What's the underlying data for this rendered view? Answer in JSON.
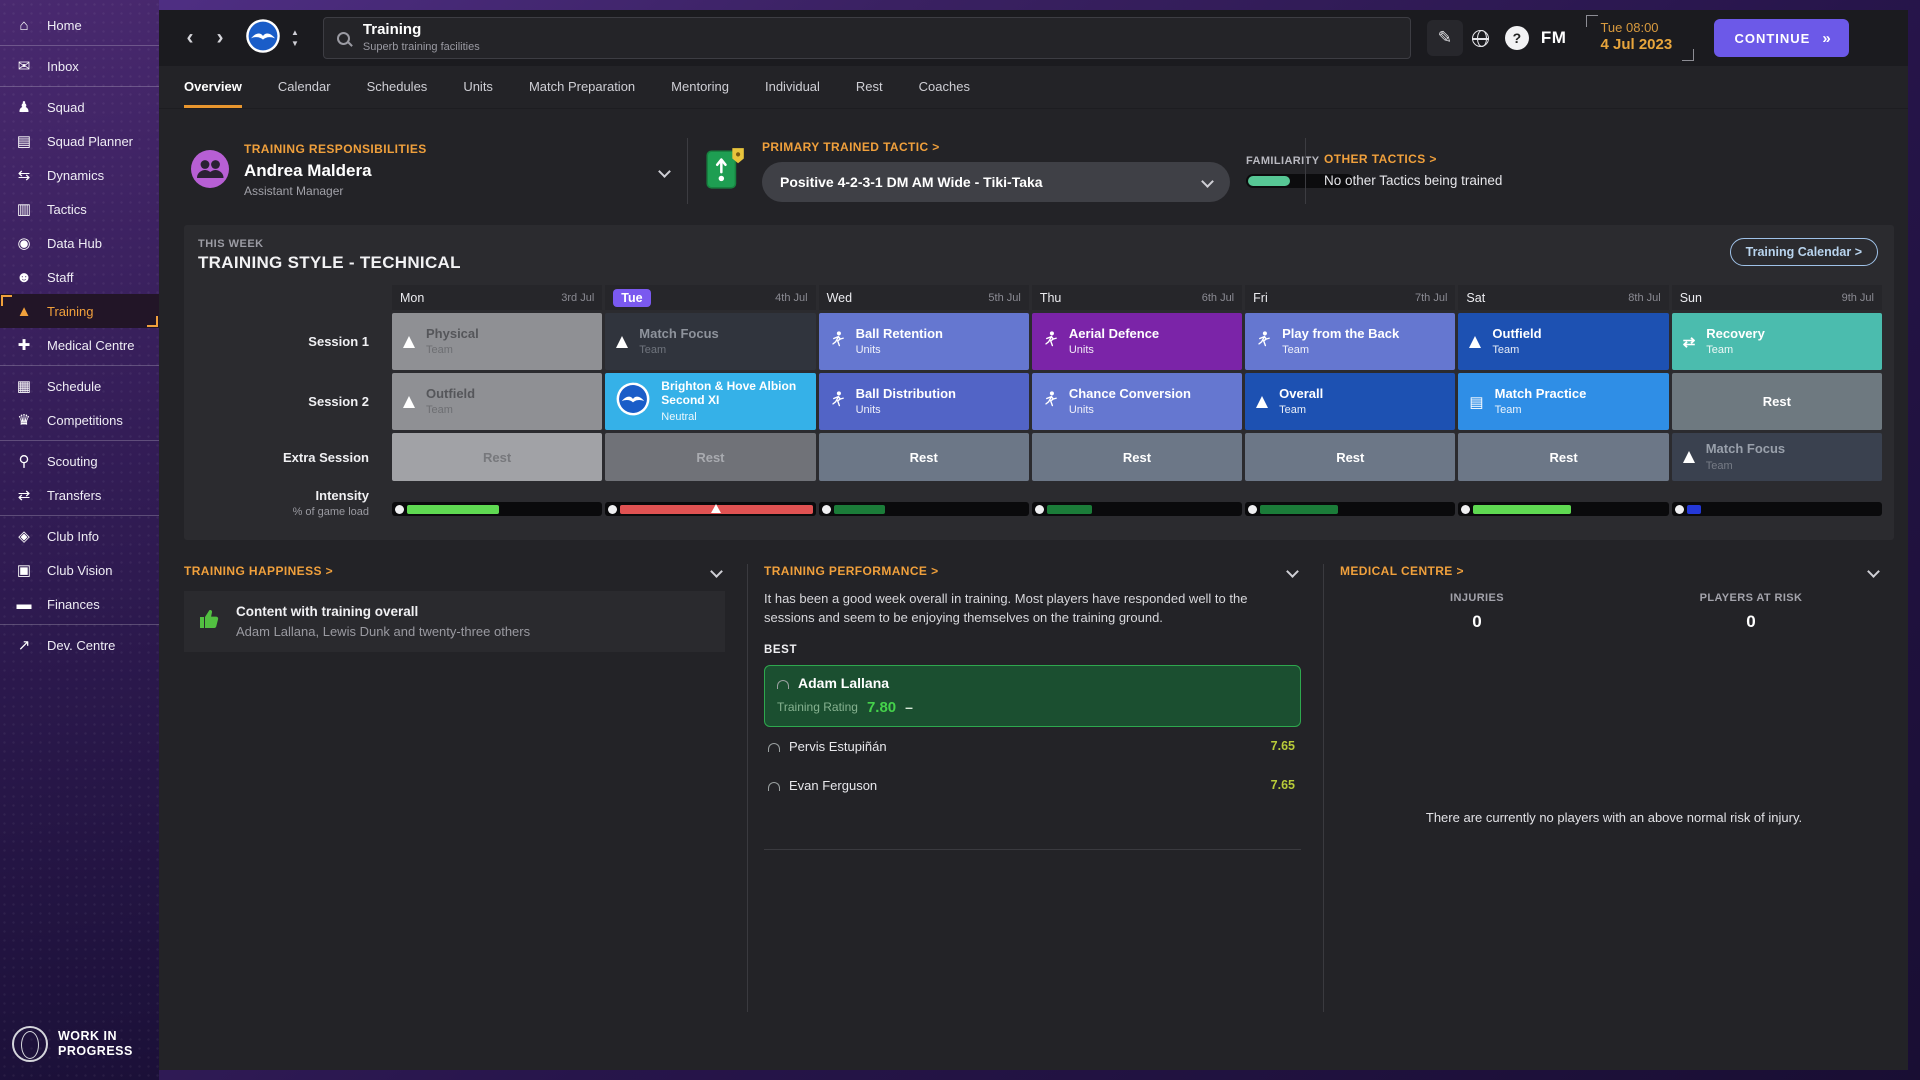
{
  "topbar": {
    "back": "‹",
    "forward": "›",
    "search_title": "Training",
    "search_subtitle": "Superb training facilities",
    "fm_label": "FM",
    "time": "Tue 08:00",
    "date": "4 Jul 2023",
    "continue_label": "CONTINUE",
    "continue_arrows": "»"
  },
  "tabs": [
    {
      "label": "Overview",
      "active": true
    },
    {
      "label": "Calendar"
    },
    {
      "label": "Schedules"
    },
    {
      "label": "Units"
    },
    {
      "label": "Match Preparation"
    },
    {
      "label": "Mentoring"
    },
    {
      "label": "Individual"
    },
    {
      "label": "Rest"
    },
    {
      "label": "Coaches"
    }
  ],
  "sidebar": {
    "items": [
      {
        "label": "Home",
        "icon": "home-icon",
        "divider_after": true
      },
      {
        "label": "Inbox",
        "icon": "inbox-icon",
        "divider_after": true
      },
      {
        "label": "Squad",
        "icon": "squad-icon"
      },
      {
        "label": "Squad Planner",
        "icon": "squad-planner-icon"
      },
      {
        "label": "Dynamics",
        "icon": "dynamics-icon"
      },
      {
        "label": "Tactics",
        "icon": "tactics-icon"
      },
      {
        "label": "Data Hub",
        "icon": "data-hub-icon"
      },
      {
        "label": "Staff",
        "icon": "staff-icon"
      },
      {
        "label": "Training",
        "icon": "training-icon",
        "active": true
      },
      {
        "label": "Medical Centre",
        "icon": "medical-centre-icon",
        "divider_after": true
      },
      {
        "label": "Schedule",
        "icon": "schedule-icon"
      },
      {
        "label": "Competitions",
        "icon": "competitions-icon",
        "divider_after": true
      },
      {
        "label": "Scouting",
        "icon": "scouting-icon"
      },
      {
        "label": "Transfers",
        "icon": "transfers-icon",
        "divider_after": true
      },
      {
        "label": "Club Info",
        "icon": "club-info-icon"
      },
      {
        "label": "Club Vision",
        "icon": "club-vision-icon"
      },
      {
        "label": "Finances",
        "icon": "finances-icon",
        "divider_after": true
      },
      {
        "label": "Dev. Centre",
        "icon": "dev-centre-icon"
      }
    ],
    "footer_line1": "WORK IN",
    "footer_line2": "PROGRESS"
  },
  "responsibilities": {
    "label": "TRAINING RESPONSIBILITIES",
    "name": "Andrea Maldera",
    "role": "Assistant Manager"
  },
  "primary_tactic": {
    "label": "PRIMARY TRAINED TACTIC >",
    "value": "Positive 4-2-3-1 DM AM Wide - Tiki-Taka",
    "familiarity_label": "FAMILIARITY",
    "familiarity_pct": 40
  },
  "other_tactics": {
    "label": "OTHER TACTICS >",
    "text": "No other Tactics being trained"
  },
  "week": {
    "eyebrow": "THIS WEEK",
    "title": "TRAINING STYLE - TECHNICAL",
    "calendar_button": "Training Calendar >",
    "row_labels": [
      "Session 1",
      "Session 2",
      "Extra Session"
    ],
    "intensity_label": "Intensity",
    "intensity_sublabel": "% of game load",
    "days": [
      {
        "name": "Mon",
        "date": "3rd Jul",
        "session1": {
          "title": "Physical",
          "sub": "Team",
          "icon": "cone-icon",
          "style": "c-past"
        },
        "session2": {
          "title": "Outfield",
          "sub": "Team",
          "icon": "cone-icon",
          "style": "c-past"
        },
        "extra": {
          "title": "Rest",
          "style": "r-past"
        },
        "intensity": {
          "pct": 45,
          "color": "#5fd952"
        }
      },
      {
        "name": "Tue",
        "date": "4th Jul",
        "today": true,
        "session1": {
          "title": "Match Focus",
          "sub": "Team",
          "icon": "cone-icon",
          "style": "c-dark"
        },
        "session2": {
          "title": "Brighton & Hove Albion Second XI",
          "sub": "Neutral",
          "icon": "club-badge-icon",
          "style": "c-match"
        },
        "extra": {
          "title": "Rest",
          "style": "r-dim"
        },
        "intensity": {
          "pct": 95,
          "color": "#e05252",
          "warning": true
        }
      },
      {
        "name": "Wed",
        "date": "5th Jul",
        "session1": {
          "title": "Ball Retention",
          "sub": "Units",
          "icon": "runner-icon",
          "style": "c-peri"
        },
        "session2": {
          "title": "Ball Distribution",
          "sub": "Units",
          "icon": "runner-icon",
          "style": "c-indigo"
        },
        "extra": {
          "title": "Rest",
          "style": "r-slate"
        },
        "intensity": {
          "pct": 25,
          "color": "#1b7c39"
        }
      },
      {
        "name": "Thu",
        "date": "6th Jul",
        "session1": {
          "title": "Aerial Defence",
          "sub": "Units",
          "icon": "runner-icon",
          "style": "c-purple"
        },
        "session2": {
          "title": "Chance Conversion",
          "sub": "Units",
          "icon": "runner-icon",
          "style": "c-peri"
        },
        "extra": {
          "title": "Rest",
          "style": "r-slate"
        },
        "intensity": {
          "pct": 22,
          "color": "#1b7c39"
        }
      },
      {
        "name": "Fri",
        "date": "7th Jul",
        "session1": {
          "title": "Play from the Back",
          "sub": "Team",
          "icon": "runner-icon",
          "style": "c-peri"
        },
        "session2": {
          "title": "Overall",
          "sub": "Team",
          "icon": "cone-icon",
          "style": "c-dblue"
        },
        "extra": {
          "title": "Rest",
          "style": "r-slate"
        },
        "intensity": {
          "pct": 38,
          "color": "#1b7c39"
        }
      },
      {
        "name": "Sat",
        "date": "8th Jul",
        "session1": {
          "title": "Outfield",
          "sub": "Team",
          "icon": "cone-icon",
          "style": "c-dblue"
        },
        "session2": {
          "title": "Match Practice",
          "sub": "Team",
          "icon": "board-icon",
          "style": "c-bblue"
        },
        "extra": {
          "title": "Rest",
          "style": "r-slate"
        },
        "intensity": {
          "pct": 48,
          "color": "#5fd952"
        }
      },
      {
        "name": "Sun",
        "date": "9th Jul",
        "session1": {
          "title": "Recovery",
          "sub": "Team",
          "icon": "arrows-icon",
          "style": "c-teal"
        },
        "session2": {
          "title": "Rest",
          "style": "r-slate2"
        },
        "extra": {
          "title": "Match Focus",
          "sub": "Team",
          "icon": "cone-icon",
          "style": "c-navy"
        },
        "intensity": {
          "pct": 7,
          "color": "#2438d8"
        }
      }
    ]
  },
  "happiness": {
    "title": "TRAINING HAPPINESS >",
    "item_title": "Content with training overall",
    "item_sub": "Adam Lallana, Lewis Dunk and twenty-three others"
  },
  "performance": {
    "title": "TRAINING PERFORMANCE >",
    "summary": "It has been a good week overall in training. Most players have responded well to the sessions and seem to be enjoying themselves on the training ground.",
    "best_label": "BEST",
    "top": {
      "name": "Adam Lallana",
      "rating_label": "Training Rating",
      "rating": "7.80",
      "trend": "–"
    },
    "others": [
      {
        "name": "Pervis Estupiñán",
        "rating": "7.65"
      },
      {
        "name": "Evan Ferguson",
        "rating": "7.65"
      }
    ]
  },
  "medical": {
    "title": "MEDICAL CENTRE >",
    "injuries_label": "INJURIES",
    "injuries_value": "0",
    "risk_label": "PLAYERS AT RISK",
    "risk_value": "0",
    "note": "There are currently no players with an above normal risk of injury."
  },
  "colors": {
    "accent_orange": "#f0a03c",
    "today_purple": "#7a59ef",
    "continue_purple": "#6c59e8",
    "familiarity_green": "#57c795"
  }
}
